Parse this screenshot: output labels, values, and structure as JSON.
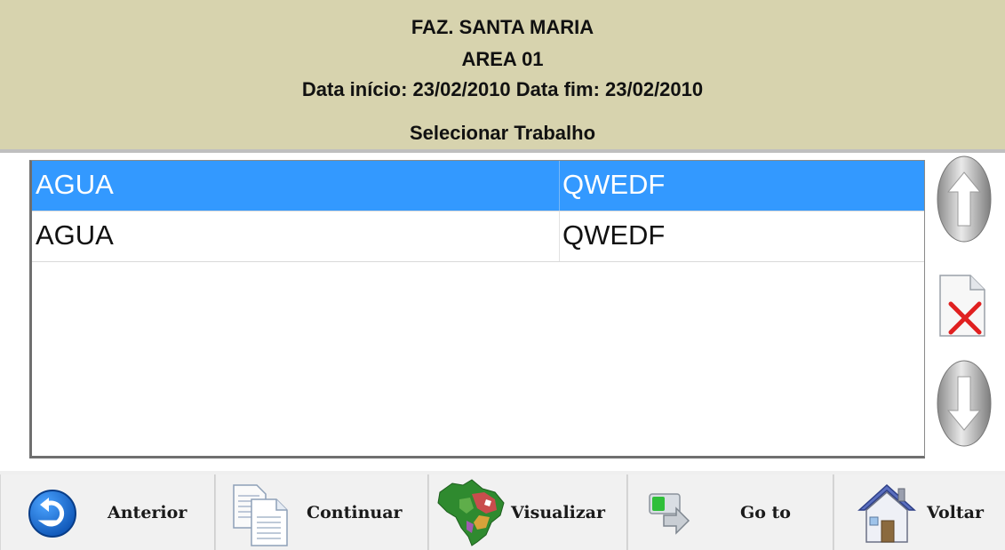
{
  "header": {
    "farm": "FAZ. SANTA MARIA",
    "area": "AREA 01",
    "dates": "Data início: 23/02/2010 Data fim: 23/02/2010",
    "subtitle": "Selecionar Trabalho"
  },
  "list": {
    "rows": [
      {
        "col1": "AGUA",
        "col2": "QWEDF",
        "selected": true
      },
      {
        "col1": "AGUA",
        "col2": "QWEDF",
        "selected": false
      }
    ]
  },
  "side_buttons": [
    "arrow-up-icon",
    "delete-document-icon",
    "arrow-down-icon"
  ],
  "toolbar": {
    "anterior": "Anterior",
    "continuar": "Continuar",
    "visualizar": "Visualizar",
    "goto": "Go to",
    "voltar": "Voltar"
  },
  "colors": {
    "header_bg": "#d7d3ae",
    "selection": "#3399ff",
    "delete_x": "#e02020"
  }
}
